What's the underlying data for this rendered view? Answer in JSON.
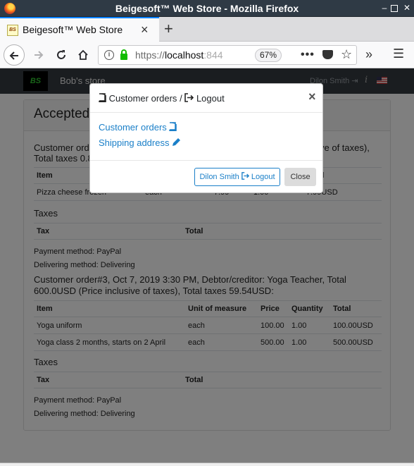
{
  "window": {
    "title": "Beigesoft™ Web Store - Mozilla Firefox"
  },
  "browser": {
    "tab_title": "Beigesoft™ Web Store",
    "favicon_text": "BS",
    "url_prefix": "https://",
    "url_host": "localhost",
    "url_rest": ":844",
    "zoom": "67%"
  },
  "site": {
    "logo_text": "BS",
    "brand": "Bob's store",
    "user_name": "Dilon Smith",
    "info_glyph": "i"
  },
  "page": {
    "heading": "Accepted",
    "order1": {
      "title_line1": "Customer order",
      "title_line1_right": "ve of taxes),",
      "title_line2": "Total taxes 0.8",
      "headers": [
        "Item",
        "",
        "",
        "",
        "Total"
      ],
      "rows": [
        [
          "Pizza cheese frozen",
          "each",
          "7.99",
          "1.00",
          "7.99USD"
        ]
      ],
      "taxes_label": "Taxes",
      "tax_headers": [
        "Tax",
        "Total"
      ],
      "payment": "Payment method: PayPal",
      "delivering": "Delivering method: Delivering"
    },
    "order3": {
      "title_line1": "Customer order#3, Oct 7, 2019 3:30 PM, Debtor/creditor: Yoga Teacher, Total",
      "title_line2": "600.0USD (Price inclusive of taxes), Total taxes 59.54USD:",
      "headers": [
        "Item",
        "Unit of measure",
        "Price",
        "Quantity",
        "Total"
      ],
      "rows": [
        [
          "Yoga uniform",
          "each",
          "100.00",
          "1.00",
          "100.00USD"
        ],
        [
          "Yoga class 2 months, starts on 2 April",
          "each",
          "500.00",
          "1.00",
          "500.00USD"
        ]
      ],
      "taxes_label": "Taxes",
      "tax_headers": [
        "Tax",
        "Total"
      ],
      "payment": "Payment method: PayPal",
      "delivering": "Delivering method: Delivering"
    }
  },
  "modal": {
    "title_part1": "Customer orders",
    "title_sep": "/",
    "title_part2": "Logout",
    "link_orders": "Customer orders",
    "link_shipping": "Shipping address",
    "logout_user": "Dilon Smith",
    "logout_label": "Logout",
    "close_label": "Close"
  },
  "colors": {
    "link": "#1a7fc8",
    "navbar": "#343a40",
    "accent": "#0a84ff"
  }
}
